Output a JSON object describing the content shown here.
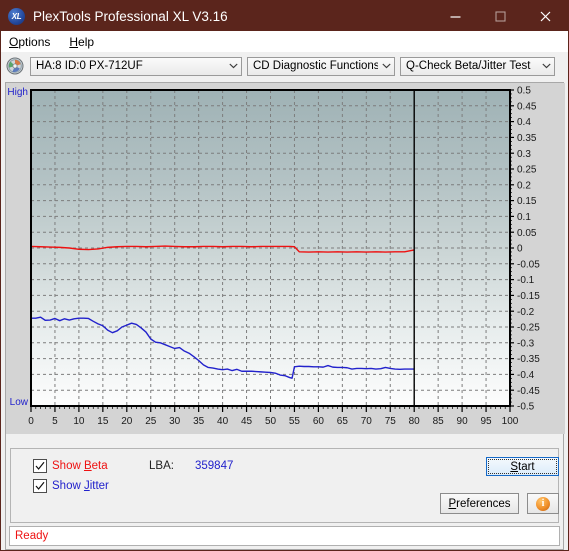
{
  "window": {
    "title": "PlexTools Professional XL V3.16",
    "app_icon": "xl-disc-icon",
    "minimize": "–",
    "maximize": "□",
    "close": "✕",
    "titlebar_color": "#5b251c"
  },
  "menubar": {
    "items": [
      {
        "label": "Options",
        "accel": "O"
      },
      {
        "label": "Help",
        "accel": "H"
      }
    ]
  },
  "toolbar": {
    "drive_icon": "cd-disc-icon",
    "drive": {
      "value": "HA:8 ID:0  PX-712UF"
    },
    "function": {
      "value": "CD Diagnostic Functions"
    },
    "test": {
      "value": "Q-Check Beta/Jitter Test"
    },
    "dropdown_arrow": "chevron-down-icon"
  },
  "chart_data": {
    "type": "line",
    "title": "",
    "xlabel": "",
    "ylabel": "",
    "xlim": [
      0,
      100
    ],
    "ylim": [
      -0.5,
      0.5
    ],
    "grid": true,
    "x_ticks": [
      0,
      5,
      10,
      15,
      20,
      25,
      30,
      35,
      40,
      45,
      50,
      55,
      60,
      65,
      70,
      75,
      80,
      85,
      90,
      95,
      100
    ],
    "y_ticks": [
      0.5,
      0.45,
      0.4,
      0.35,
      0.3,
      0.25,
      0.2,
      0.15,
      0.1,
      0.05,
      0,
      -0.05,
      -0.1,
      -0.15,
      -0.2,
      -0.25,
      -0.3,
      -0.35,
      -0.4,
      -0.45,
      -0.5
    ],
    "axis_top_label": "High",
    "axis_bottom_label": "Low",
    "data_end_x": 80,
    "legend_position": "bottom-external",
    "series": [
      {
        "name": "Beta",
        "color": "#ee1111",
        "x": [
          0,
          2,
          4,
          6,
          8,
          10,
          12,
          14,
          16,
          18,
          20,
          22,
          24,
          26,
          28,
          30,
          32,
          34,
          36,
          38,
          40,
          42,
          44,
          46,
          48,
          50,
          52,
          54,
          55,
          56,
          58,
          60,
          62,
          64,
          66,
          68,
          70,
          72,
          74,
          76,
          78,
          80
        ],
        "y": [
          0.005,
          0.004,
          0.003,
          0.002,
          0.0,
          -0.004,
          -0.005,
          -0.003,
          0.002,
          0.004,
          0.005,
          0.005,
          0.004,
          0.005,
          0.006,
          0.005,
          0.004,
          0.004,
          0.005,
          0.005,
          0.004,
          0.005,
          0.005,
          0.004,
          0.005,
          0.005,
          0.005,
          0.005,
          0.004,
          -0.012,
          -0.013,
          -0.012,
          -0.013,
          -0.012,
          -0.013,
          -0.012,
          -0.013,
          -0.012,
          -0.013,
          -0.012,
          -0.012,
          -0.006
        ]
      },
      {
        "name": "Jitter",
        "color": "#2222cc",
        "x": [
          0,
          1,
          2,
          3,
          4,
          5,
          6,
          7,
          8,
          9,
          10,
          11,
          12,
          13,
          14,
          15,
          16,
          17,
          18,
          19,
          20,
          21,
          22,
          23,
          24,
          25,
          26,
          27,
          28,
          29,
          30,
          31,
          32,
          33,
          34,
          35,
          36,
          37,
          38,
          39,
          40,
          41,
          42,
          43,
          44,
          45,
          46,
          47,
          48,
          49,
          50,
          51,
          52,
          53,
          54,
          54.5,
          55,
          56,
          57,
          58,
          59,
          60,
          61,
          62,
          63,
          64,
          65,
          66,
          67,
          68,
          69,
          70,
          71,
          72,
          73,
          74,
          75,
          76,
          77,
          78,
          79,
          80
        ],
        "y": [
          -0.222,
          -0.222,
          -0.219,
          -0.229,
          -0.228,
          -0.223,
          -0.23,
          -0.224,
          -0.228,
          -0.224,
          -0.222,
          -0.222,
          -0.223,
          -0.232,
          -0.24,
          -0.246,
          -0.26,
          -0.268,
          -0.262,
          -0.25,
          -0.244,
          -0.238,
          -0.242,
          -0.253,
          -0.266,
          -0.288,
          -0.298,
          -0.3,
          -0.306,
          -0.312,
          -0.318,
          -0.315,
          -0.326,
          -0.333,
          -0.344,
          -0.356,
          -0.37,
          -0.378,
          -0.38,
          -0.383,
          -0.385,
          -0.383,
          -0.388,
          -0.384,
          -0.39,
          -0.39,
          -0.39,
          -0.391,
          -0.392,
          -0.393,
          -0.394,
          -0.396,
          -0.402,
          -0.404,
          -0.41,
          -0.412,
          -0.376,
          -0.374,
          -0.375,
          -0.375,
          -0.376,
          -0.376,
          -0.377,
          -0.372,
          -0.377,
          -0.378,
          -0.378,
          -0.379,
          -0.383,
          -0.381,
          -0.381,
          -0.382,
          -0.381,
          -0.383,
          -0.382,
          -0.378,
          -0.381,
          -0.383,
          -0.384,
          -0.383,
          -0.383,
          -0.383
        ]
      }
    ]
  },
  "controls": {
    "show_beta": {
      "label_pre": "Show ",
      "accel": "B",
      "label_post": "eta",
      "checked": true
    },
    "show_jitter": {
      "label_pre": "Show ",
      "accel": "J",
      "label_post": "itter",
      "checked": true
    },
    "lba_label": "LBA:",
    "lba_value": "359847",
    "start_button": {
      "pre": "",
      "accel": "S",
      "post": "tart"
    },
    "preferences_button": {
      "pre": "",
      "accel": "P",
      "post": "references"
    },
    "info_button": {
      "icon": "info-icon",
      "glyph": "i"
    }
  },
  "statusbar": {
    "text": "Ready"
  }
}
